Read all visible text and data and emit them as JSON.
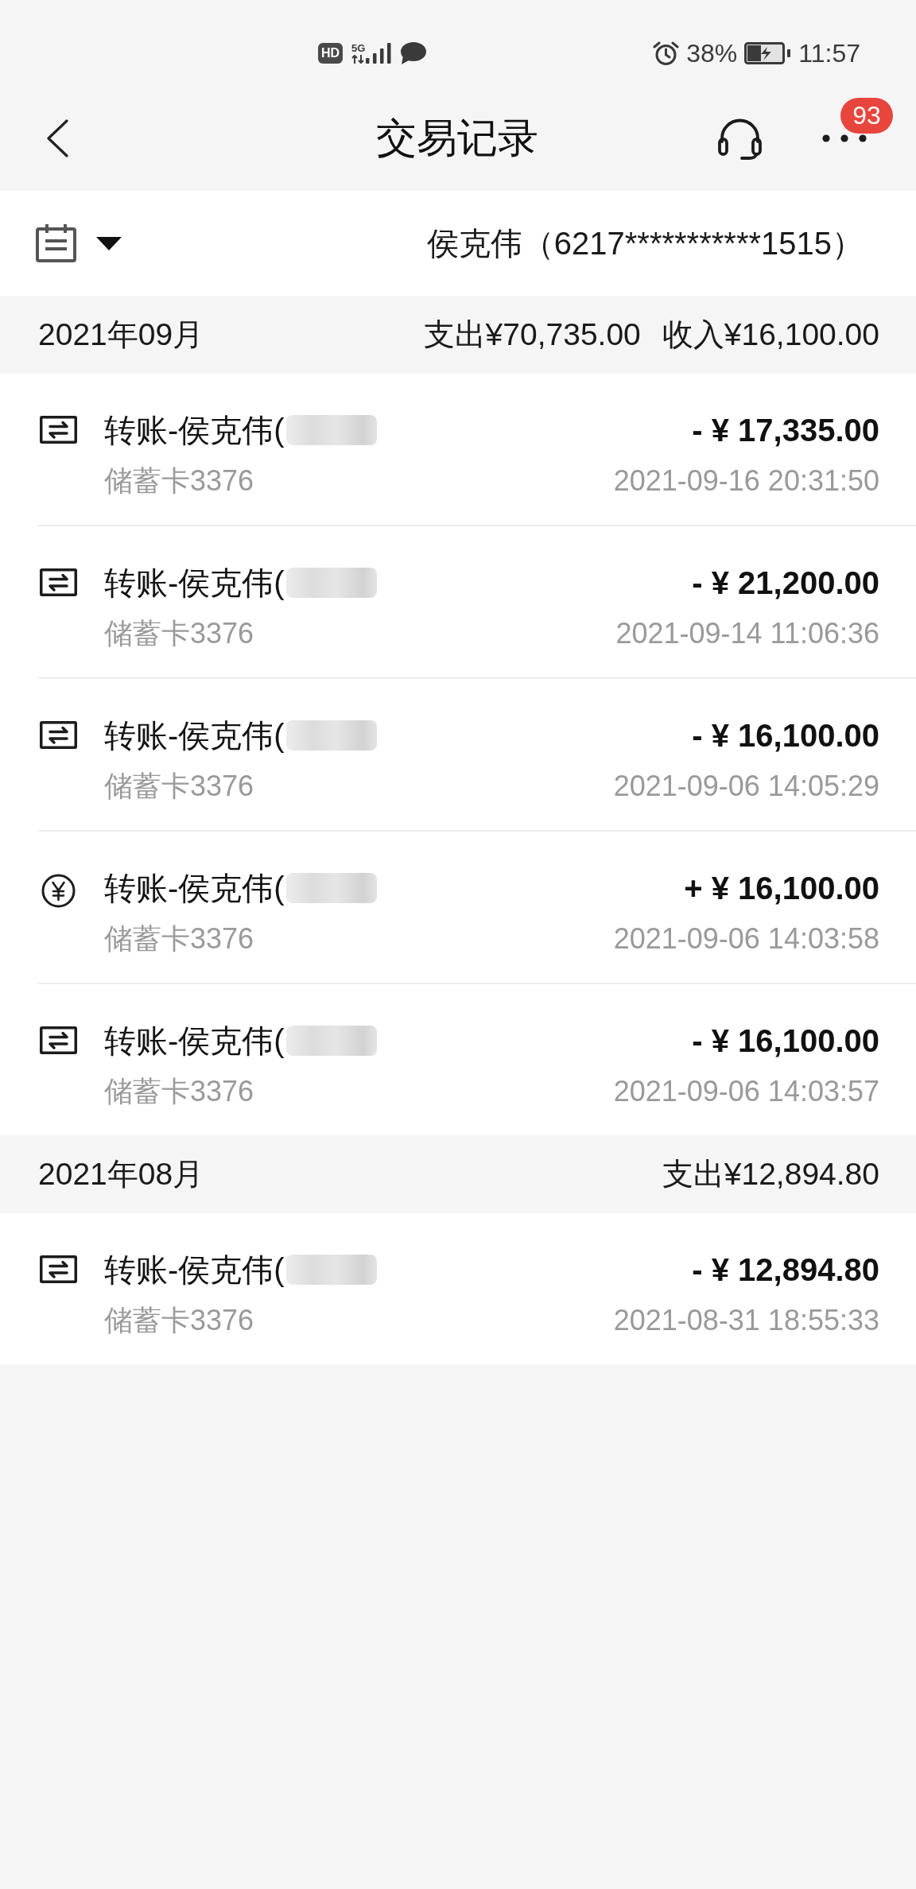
{
  "status_bar": {
    "hd_badge": "HD",
    "network": "5G",
    "battery_percent": "38%",
    "time": "11:57"
  },
  "header": {
    "title": "交易记录",
    "notification_count": "93"
  },
  "account_bar": {
    "account": "侯克伟（6217***********1515）"
  },
  "months": [
    {
      "month": "2021年09月",
      "totals": [
        "支出¥70,735.00",
        "收入¥16,100.00"
      ],
      "transactions": [
        {
          "kind": "transfer",
          "title": "转账-侯克伟(",
          "redacted": true,
          "card": "储蓄卡3376",
          "amount": "- ¥ 17,335.00",
          "time": "2021-09-16 20:31:50"
        },
        {
          "kind": "transfer",
          "title": "转账-侯克伟(",
          "redacted": true,
          "card": "储蓄卡3376",
          "amount": "- ¥ 21,200.00",
          "time": "2021-09-14 11:06:36"
        },
        {
          "kind": "transfer",
          "title": "转账-侯克伟(",
          "redacted": true,
          "card": "储蓄卡3376",
          "amount": "- ¥ 16,100.00",
          "time": "2021-09-06 14:05:29"
        },
        {
          "kind": "income",
          "title": "转账-侯克伟(",
          "redacted": true,
          "card": "储蓄卡3376",
          "amount": "+ ¥ 16,100.00",
          "time": "2021-09-06 14:03:58"
        },
        {
          "kind": "transfer",
          "title": "转账-侯克伟(",
          "redacted": true,
          "card": "储蓄卡3376",
          "amount": "- ¥ 16,100.00",
          "time": "2021-09-06 14:03:57"
        }
      ]
    },
    {
      "month": "2021年08月",
      "totals": [
        "支出¥12,894.80"
      ],
      "transactions": [
        {
          "kind": "transfer",
          "title": "转账-侯克伟(",
          "redacted": true,
          "card": "储蓄卡3376",
          "amount": "- ¥ 12,894.80",
          "time": "2021-08-31 18:55:33"
        }
      ]
    }
  ]
}
